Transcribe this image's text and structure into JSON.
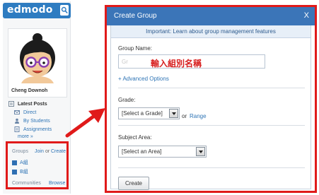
{
  "logo": {
    "text": "edmodo",
    "icon": "search-icon"
  },
  "profile": {
    "name": "Cheng Downoh"
  },
  "latest_posts": {
    "title": "Latest Posts",
    "links": [
      "Direct",
      "By Students",
      "Assignments"
    ],
    "more": "more"
  },
  "groups_section": {
    "heading": "Groups",
    "join": "Join",
    "or": "or",
    "create": "Create",
    "items": [
      "A組",
      "B組"
    ],
    "communities_heading": "Communities",
    "browse": "Browse"
  },
  "modal": {
    "title": "Create Group",
    "close": "X",
    "info": "Important: Learn about group management features",
    "group_name_label": "Group Name:",
    "group_name_placeholder": "Gr",
    "overlay_hint": "輸入組別名稱",
    "advanced_options": "+ Advanced Options",
    "grade_label": "Grade:",
    "grade_select": "[Select a Grade]",
    "grade_or": "or",
    "range_link": "Range",
    "subject_label": "Subject Area:",
    "subject_select": "[Select an Area]",
    "create_button": "Create"
  },
  "colors": {
    "brand_blue": "#2e7cc1",
    "titlebar_blue": "#3b75b8",
    "link_blue": "#2e74b5",
    "highlight_red": "#e01a1a"
  }
}
